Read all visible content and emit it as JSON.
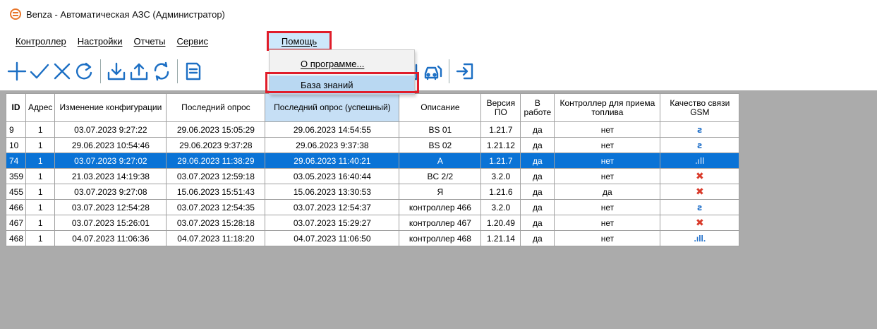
{
  "window": {
    "title": "Benza - Автоматическая АЗС (Администратор)"
  },
  "menu": {
    "items": [
      {
        "label": "Контроллер"
      },
      {
        "label": "Настройки"
      },
      {
        "label": "Отчеты"
      },
      {
        "label": "Сервис"
      },
      {
        "label": "Помощь"
      }
    ]
  },
  "help_menu": {
    "items": [
      {
        "label": "О программе..."
      },
      {
        "label": "База знаний"
      }
    ]
  },
  "toolbar": {
    "icons": [
      "plus-icon",
      "check-icon",
      "cross-icon",
      "refresh-icon",
      "download-icon",
      "upload-icon",
      "sync-icon",
      "document-icon",
      "fuel-pump-icon",
      "fuel-edit-icon",
      "bar-chart-icon",
      "car-fuel-icon",
      "login-icon"
    ]
  },
  "table": {
    "columns": [
      "ID",
      "Адрес",
      "Изменение конфигурации",
      "Последний опрос",
      "Последний опрос (успешный)",
      "Описание",
      "Версия ПО",
      "В работе",
      "Контроллер для приема топлива",
      "Качество связи GSM"
    ],
    "rows": [
      {
        "id": "9",
        "addr": "1",
        "config": "03.07.2023 9:27:22",
        "last": "29.06.2023 15:05:29",
        "last_ok": "29.06.2023 14:54:55",
        "desc": "BS 01",
        "ver": "1.21.7",
        "work": "да",
        "fuel": "нет",
        "gsm": "ꙅ"
      },
      {
        "id": "10",
        "addr": "1",
        "config": "29.06.2023 10:54:46",
        "last": "29.06.2023 9:37:28",
        "last_ok": "29.06.2023 9:37:38",
        "desc": "BS 02",
        "ver": "1.21.12",
        "work": "да",
        "fuel": "нет",
        "gsm": "ꙅ"
      },
      {
        "id": "74",
        "addr": "1",
        "config": "03.07.2023 9:27:02",
        "last": "29.06.2023 11:38:29",
        "last_ok": "29.06.2023 11:40:21",
        "desc": "A",
        "ver": "1.21.7",
        "work": "да",
        "fuel": "нет",
        "gsm": ".ıll"
      },
      {
        "id": "359",
        "addr": "1",
        "config": "21.03.2023 14:19:38",
        "last": "03.07.2023 12:59:18",
        "last_ok": "03.05.2023 16:40:44",
        "desc": "BC 2/2",
        "ver": "3.2.0",
        "work": "да",
        "fuel": "нет",
        "gsm": "✖"
      },
      {
        "id": "455",
        "addr": "1",
        "config": "03.07.2023 9:27:08",
        "last": "15.06.2023 15:51:43",
        "last_ok": "15.06.2023 13:30:53",
        "desc": "Я",
        "ver": "1.21.6",
        "work": "да",
        "fuel": "да",
        "gsm": "✖"
      },
      {
        "id": "466",
        "addr": "1",
        "config": "03.07.2023 12:54:28",
        "last": "03.07.2023 12:54:35",
        "last_ok": "03.07.2023 12:54:37",
        "desc": "контроллер 466",
        "ver": "3.2.0",
        "work": "да",
        "fuel": "нет",
        "gsm": "ꙅ"
      },
      {
        "id": "467",
        "addr": "1",
        "config": "03.07.2023 15:26:01",
        "last": "03.07.2023 15:28:18",
        "last_ok": "03.07.2023 15:29:27",
        "desc": "контроллер 467",
        "ver": "1.20.49",
        "work": "да",
        "fuel": "нет",
        "gsm": "✖"
      },
      {
        "id": "468",
        "addr": "1",
        "config": "04.07.2023 11:06:36",
        "last": "04.07.2023 11:18:20",
        "last_ok": "04.07.2023 11:06:50",
        "desc": "контроллер 468",
        "ver": "1.21.14",
        "work": "да",
        "fuel": "нет",
        "gsm": ".ıll."
      }
    ],
    "selected_row_id": "74",
    "colors": {
      "selection": "#0a73d6",
      "highlight_box": "#e01d2a",
      "icon": "#1c6fc4"
    }
  }
}
